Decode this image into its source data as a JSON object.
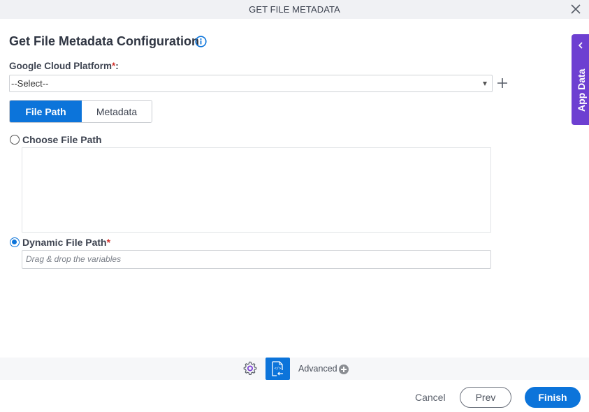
{
  "window": {
    "title": "GET FILE METADATA"
  },
  "form": {
    "heading": "Get File Metadata Configuration",
    "gcp_label": "Google Cloud Platform",
    "gcp_required": "*",
    "gcp_colon": ":",
    "gcp_select_value": "--Select--",
    "tabs": [
      {
        "label": "File Path",
        "active": true
      },
      {
        "label": "Metadata",
        "active": false
      }
    ],
    "choose_file_path_label": "Choose File Path",
    "dynamic_file_path_label": "Dynamic File Path",
    "dynamic_required": "*",
    "dynamic_placeholder": "Drag & drop the variables",
    "selected_option": "Dynamic File Path"
  },
  "side_panel": {
    "label": "App Data"
  },
  "bottom_toolbar": {
    "advanced_label": "Advanced"
  },
  "footer": {
    "cancel_label": "Cancel",
    "prev_label": "Prev",
    "finish_label": "Finish"
  },
  "colors": {
    "primary": "#0c74da",
    "app_data": "#6d3fd1",
    "required": "#d0332e"
  }
}
